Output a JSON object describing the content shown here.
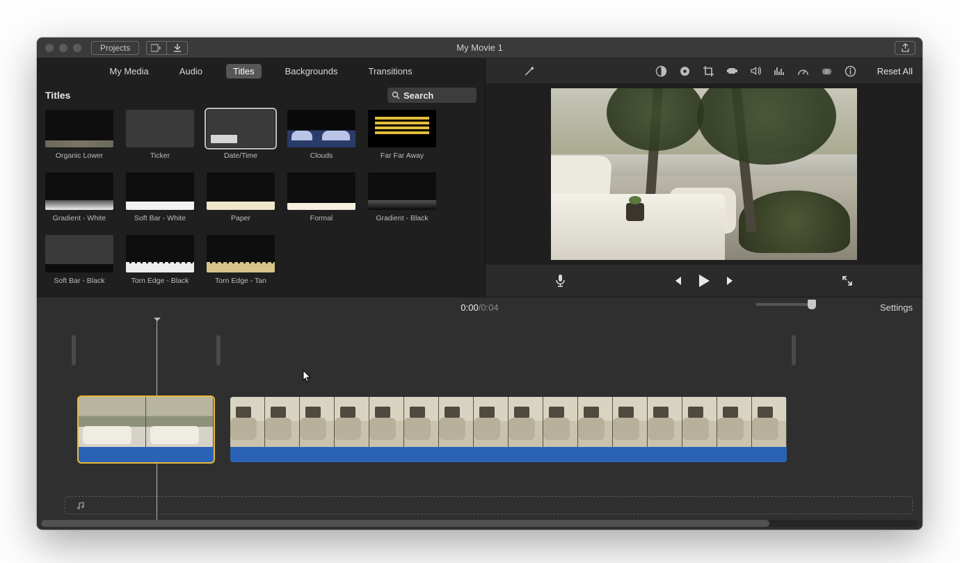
{
  "window": {
    "title": "My Movie 1",
    "projects_button": "Projects"
  },
  "tabs": {
    "items": [
      "My Media",
      "Audio",
      "Titles",
      "Backgrounds",
      "Transitions"
    ],
    "active_index": 2
  },
  "browser": {
    "section_title": "Titles",
    "search_placeholder": "Search",
    "tiles": [
      {
        "label": "Organic Lower",
        "variant": "organic"
      },
      {
        "label": "Ticker",
        "variant": "ticker"
      },
      {
        "label": "Date/Time",
        "variant": "datetime",
        "selected": true
      },
      {
        "label": "Clouds",
        "variant": "clouds"
      },
      {
        "label": "Far Far Away",
        "variant": "far"
      },
      {
        "label": "Gradient - White",
        "variant": "gw"
      },
      {
        "label": "Soft Bar - White",
        "variant": "sbw"
      },
      {
        "label": "Paper",
        "variant": "paper"
      },
      {
        "label": "Formal",
        "variant": "formal"
      },
      {
        "label": "Gradient - Black",
        "variant": "gb"
      },
      {
        "label": "Soft Bar - Black",
        "variant": "sbb"
      },
      {
        "label": "Torn Edge - Black",
        "variant": "teb"
      },
      {
        "label": "Torn Edge - Tan",
        "variant": "tet"
      }
    ]
  },
  "inspector": {
    "reset_label": "Reset All",
    "tools": [
      "auto-enhance",
      "color-balance",
      "color-correct",
      "crop",
      "stabilize",
      "audio",
      "eq",
      "speed",
      "color-filter",
      "info"
    ]
  },
  "playback": {
    "position": "0:00",
    "duration": "0:04",
    "separator": " / "
  },
  "timeline": {
    "settings_label": "Settings"
  }
}
